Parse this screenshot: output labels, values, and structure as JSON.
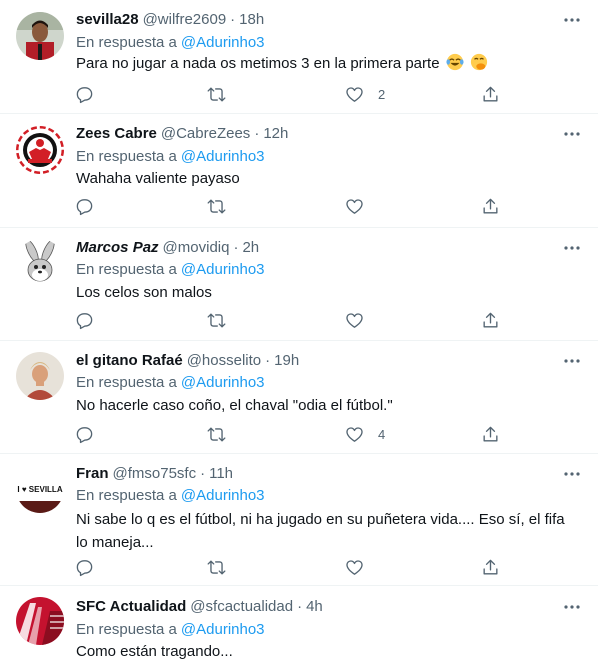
{
  "reply_prefix": "En respuesta a",
  "tweets": [
    {
      "name": "sevilla28",
      "handle": "@wilfre2609",
      "time": "18h",
      "reply_to": "@Adurinho3",
      "text": "Para no jugar a nada os metimos 3 en la primera parte",
      "emojis": [
        "face-with-tears-of-joy-emoji",
        "face-with-hand-over-mouth-emoji"
      ],
      "likes": "2"
    },
    {
      "name": "Zees Cabre",
      "handle": "@CabreZees",
      "time": "12h",
      "reply_to": "@Adurinho3",
      "text": "Wahaha valiente payaso",
      "likes": ""
    },
    {
      "name": "Marcos Paz",
      "handle": "@movidiq",
      "time": "2h",
      "reply_to": "@Adurinho3",
      "text": "Los celos son malos",
      "likes": ""
    },
    {
      "name": "el gitano Rafaé",
      "handle": "@hosselito",
      "time": "19h",
      "reply_to": "@Adurinho3",
      "text": "No hacerle caso coño, el chaval \"odia el fútbol.\"",
      "likes": "4"
    },
    {
      "name": "Fran",
      "handle": "@fmso75sfc",
      "time": "11h",
      "reply_to": "@Adurinho3",
      "text": "Ni sabe lo q es el fútbol, ni ha jugado en su puñetera vida.... Eso sí, el fifa lo maneja...",
      "avatar_text": "I ♥ SEVILLA",
      "likes": ""
    },
    {
      "name": "SFC Actualidad",
      "handle": "@sfcactualidad",
      "time": "4h",
      "reply_to": "@Adurinho3",
      "text": "Como están tragando...",
      "likes": ""
    }
  ],
  "colors": {
    "text": "#0f1419",
    "secondary": "#536471",
    "link": "#1d9bf0",
    "divider": "#eff3f4"
  }
}
